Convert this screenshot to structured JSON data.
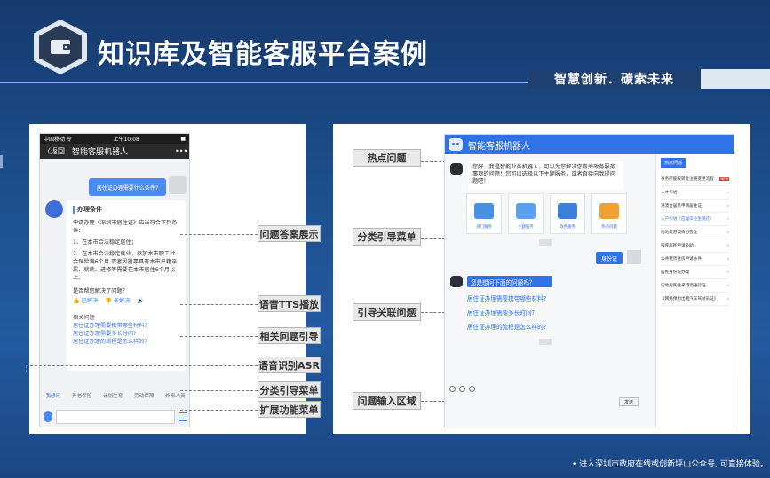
{
  "header": {
    "title": "知识库及智能客服平台案例",
    "slogan": "智慧创新．碳索未来",
    "logo_icon": "wallet-icon"
  },
  "mobile": {
    "status_carrier": "中国移动 令",
    "status_time": "上午10:08",
    "status_battery": "■",
    "back_label": "〈返回",
    "title": "智能客服机器人",
    "more_label": "•••",
    "user_question": "居住证办理需要什么条件?",
    "answer_title": "办理条件",
    "answer_lines": [
      "申请办理《深圳市居住证》应当符合下列条件：",
      "1、在本市合法稳定居住；",
      "2、在本市合法稳定就业，参加本市职工社会保险满6个月,或者因投靠具有本市户籍亲属、就读、进修等需要在本市居住6个月以上。"
    ],
    "feedback_question": "是否帮您解决了问题？",
    "feedback_yes": "👍 已解决",
    "feedback_no": "👎 未解决",
    "related_title": "相关问题",
    "related_links": [
      "居住证办理需要携带哪些材料?",
      "居住证办理需要多长时间?",
      "居住证办理的流程是怎么样的?"
    ],
    "categories": [
      "我想问",
      "养老保险",
      "计划生育",
      "劳动保障",
      "外来人员"
    ]
  },
  "left_callouts": {
    "answer_display": "问题答案展示",
    "tts": "语音TTS播放",
    "related_guide": "相关问题引导",
    "asr": "语音识别ASR",
    "category_menu": "分类引导菜单",
    "extend_menu": "扩展功能菜单"
  },
  "right_callouts": {
    "hot_questions": "热点问题",
    "category_menu": "分类引导菜单",
    "related_guide": "引导关联问题",
    "input_area": "问题输入区域"
  },
  "desktop": {
    "title": "智能客服机器人",
    "greeting": "您好，我是智能业务机器人，可以为您解决您有关政务服务事项的问题！您可以选择以下主题服务，或者直接向我提问题吧！",
    "cards": [
      "部门服务",
      "主题服务",
      "政务服务",
      "热点问题"
    ],
    "user_msg": "身份证",
    "guide_question": "您是想问下面的问题吗？",
    "guide_links": [
      "居住证办理需要携带哪些材料?",
      "居住证办理需要多长时间?",
      "居住证办理的流程是怎么样的?"
    ],
    "send_label": "发送",
    "hot_tab": "热点问题",
    "hot_items": [
      "事务所股权转让注册变更流程",
      "人才引进",
      "港澳台居民申请居住证",
      "入户引进（应届毕业生随迁）",
      "内地赴港澳商务签注",
      "残疾居民申请补助",
      "公共租赁住房申请条件",
      "居民身份证办理",
      "内地居民往来港澳通行证",
      "《网络预约出租汽车驾驶员证》"
    ],
    "hot_badge": "NEW"
  },
  "footer": {
    "text": "•  进入深圳市政府在线或创新坪山公众号, 可直接体验。"
  },
  "colors": {
    "accent": "#2f73e6",
    "background_top": "#163a6e",
    "background_bottom": "#235aa0"
  }
}
